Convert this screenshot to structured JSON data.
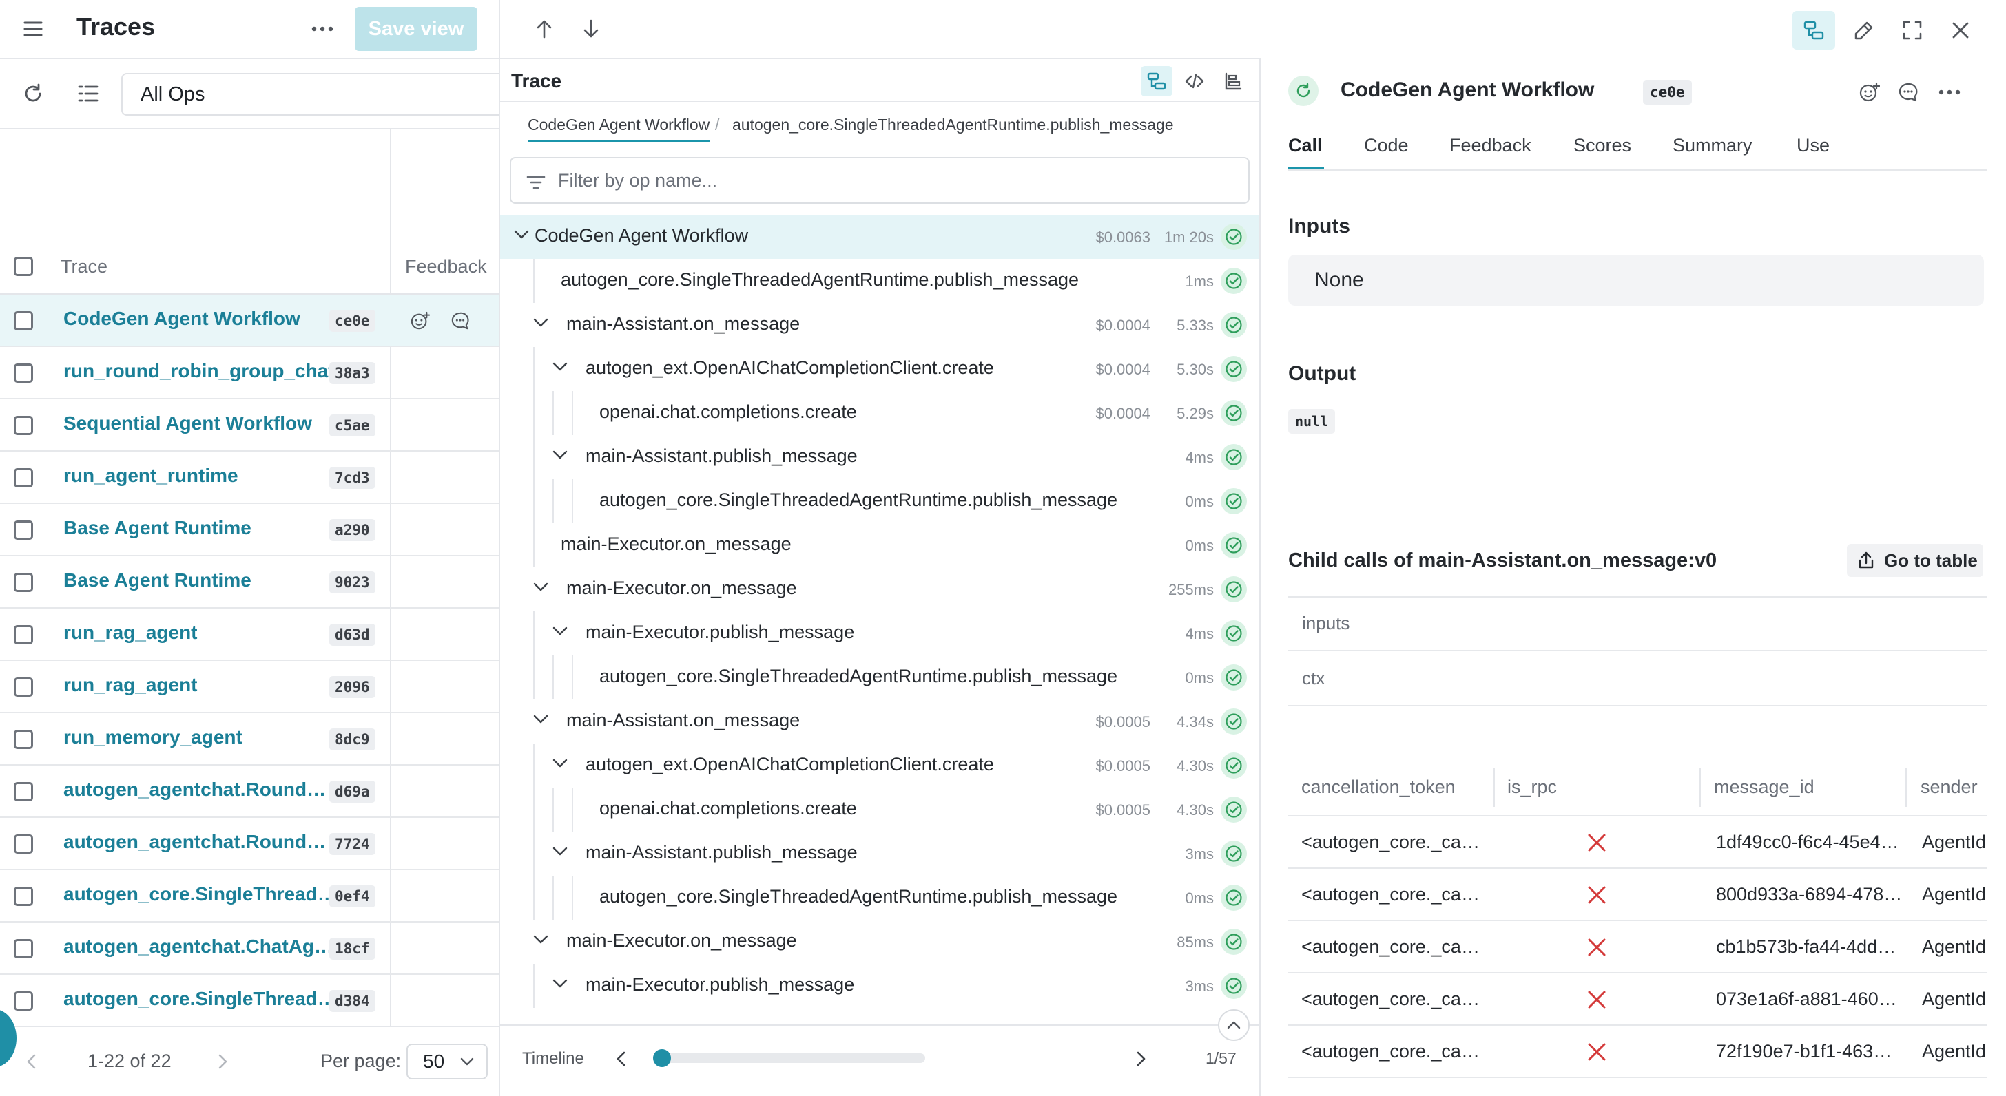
{
  "left": {
    "title": "Traces",
    "save_view": "Save view",
    "filter_value": "All Ops",
    "columns": {
      "trace": "Trace",
      "feedback": "Feedback"
    },
    "rows": [
      {
        "name": "CodeGen Agent Workflow",
        "id": "ce0e",
        "selected": true
      },
      {
        "name": "run_round_robin_group_chat",
        "id": "38a3"
      },
      {
        "name": "Sequential Agent Workflow",
        "id": "c5ae"
      },
      {
        "name": "run_agent_runtime",
        "id": "7cd3"
      },
      {
        "name": "Base Agent Runtime",
        "id": "a290"
      },
      {
        "name": "Base Agent Runtime",
        "id": "9023"
      },
      {
        "name": "run_rag_agent",
        "id": "d63d"
      },
      {
        "name": "run_rag_agent",
        "id": "2096"
      },
      {
        "name": "run_memory_agent",
        "id": "8dc9"
      },
      {
        "name": "autogen_agentchat.Round…",
        "id": "d69a"
      },
      {
        "name": "autogen_agentchat.Round…",
        "id": "7724"
      },
      {
        "name": "autogen_core.SingleThread…",
        "id": "0ef4"
      },
      {
        "name": "autogen_agentchat.ChatAg…",
        "id": "18cf"
      },
      {
        "name": "autogen_core.SingleThread…",
        "id": "d384"
      }
    ],
    "pager": {
      "range": "1-22 of 22",
      "per_page_label": "Per page:",
      "per_page_value": "50"
    }
  },
  "middle": {
    "title": "Trace",
    "breadcrumb": [
      "CodeGen Agent Workflow",
      "autogen_core.SingleThreadedAgentRuntime.publish_message"
    ],
    "breadcrumb_sep": "/",
    "filter_placeholder": "Filter by op name...",
    "tree": [
      {
        "label": "CodeGen Agent Workflow",
        "cost": "$0.0063",
        "time": "1m 20s",
        "depth": 0,
        "expandable": true,
        "selected": true
      },
      {
        "label": "autogen_core.SingleThreadedAgentRuntime.publish_message",
        "cost": "",
        "time": "1ms",
        "depth": 1,
        "expandable": false
      },
      {
        "label": "main-Assistant.on_message",
        "cost": "$0.0004",
        "time": "5.33s",
        "depth": 1,
        "expandable": true
      },
      {
        "label": "autogen_ext.OpenAIChatCompletionClient.create",
        "cost": "$0.0004",
        "time": "5.30s",
        "depth": 2,
        "expandable": true
      },
      {
        "label": "openai.chat.completions.create",
        "cost": "$0.0004",
        "time": "5.29s",
        "depth": 3,
        "expandable": false
      },
      {
        "label": "main-Assistant.publish_message",
        "cost": "",
        "time": "4ms",
        "depth": 2,
        "expandable": true
      },
      {
        "label": "autogen_core.SingleThreadedAgentRuntime.publish_message",
        "cost": "",
        "time": "0ms",
        "depth": 3,
        "expandable": false
      },
      {
        "label": "main-Executor.on_message",
        "cost": "",
        "time": "0ms",
        "depth": 1,
        "expandable": false
      },
      {
        "label": "main-Executor.on_message",
        "cost": "",
        "time": "255ms",
        "depth": 1,
        "expandable": true
      },
      {
        "label": "main-Executor.publish_message",
        "cost": "",
        "time": "4ms",
        "depth": 2,
        "expandable": true
      },
      {
        "label": "autogen_core.SingleThreadedAgentRuntime.publish_message",
        "cost": "",
        "time": "0ms",
        "depth": 3,
        "expandable": false
      },
      {
        "label": "main-Assistant.on_message",
        "cost": "$0.0005",
        "time": "4.34s",
        "depth": 1,
        "expandable": true
      },
      {
        "label": "autogen_ext.OpenAIChatCompletionClient.create",
        "cost": "$0.0005",
        "time": "4.30s",
        "depth": 2,
        "expandable": true
      },
      {
        "label": "openai.chat.completions.create",
        "cost": "$0.0005",
        "time": "4.30s",
        "depth": 3,
        "expandable": false
      },
      {
        "label": "main-Assistant.publish_message",
        "cost": "",
        "time": "3ms",
        "depth": 2,
        "expandable": true
      },
      {
        "label": "autogen_core.SingleThreadedAgentRuntime.publish_message",
        "cost": "",
        "time": "0ms",
        "depth": 3,
        "expandable": false
      },
      {
        "label": "main-Executor.on_message",
        "cost": "",
        "time": "85ms",
        "depth": 1,
        "expandable": true
      },
      {
        "label": "main-Executor.publish_message",
        "cost": "",
        "time": "3ms",
        "depth": 2,
        "expandable": true
      }
    ],
    "timeline": {
      "label": "Timeline",
      "position": "1/57",
      "current": 1,
      "total": 57
    }
  },
  "right": {
    "call_title": "CodeGen Agent Workflow",
    "call_id": "ce0e",
    "tabs": [
      "Call",
      "Code",
      "Feedback",
      "Scores",
      "Summary",
      "Use"
    ],
    "active_tab": "Call",
    "inputs_title": "Inputs",
    "inputs_value": "None",
    "output_title": "Output",
    "output_value": "null",
    "child_title": "Child calls of main-Assistant.on_message:v0",
    "go_to_table": "Go to table",
    "kv": [
      "inputs",
      "ctx"
    ],
    "table": {
      "columns": [
        "cancellation_token",
        "is_rpc",
        "message_id",
        "sender"
      ],
      "rows": [
        {
          "cancellation_token": "<autogen_core._ca…",
          "is_rpc": false,
          "message_id": "1df49cc0-f6c4-45e4…",
          "sender": "AgentId"
        },
        {
          "cancellation_token": "<autogen_core._ca…",
          "is_rpc": false,
          "message_id": "800d933a-6894-478…",
          "sender": "AgentId"
        },
        {
          "cancellation_token": "<autogen_core._ca…",
          "is_rpc": false,
          "message_id": "cb1b573b-fa44-4dd…",
          "sender": "AgentId"
        },
        {
          "cancellation_token": "<autogen_core._ca…",
          "is_rpc": false,
          "message_id": "073e1a6f-a881-460…",
          "sender": "AgentId"
        },
        {
          "cancellation_token": "<autogen_core._ca…",
          "is_rpc": false,
          "message_id": "72f190e7-b1f1-463…",
          "sender": "AgentId"
        }
      ]
    }
  },
  "colors": {
    "accent": "#1b95ab",
    "link": "#1b7f97",
    "success": "#2e9e5b",
    "error": "#d43a3a"
  }
}
